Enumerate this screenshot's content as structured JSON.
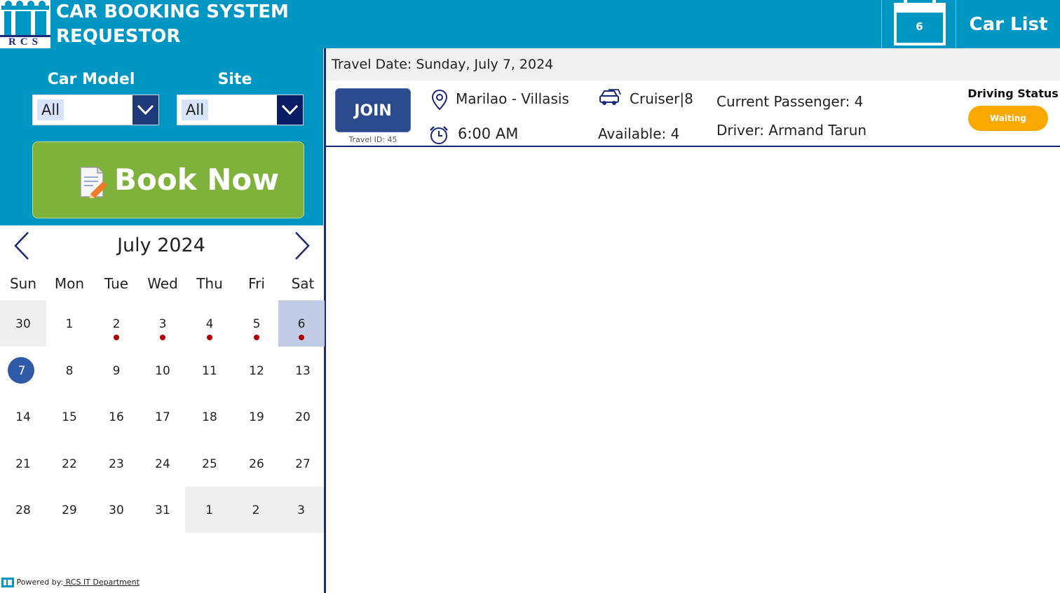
{
  "header": {
    "title_line1": "CAR BOOKING SYSTEM",
    "title_line2": "REQUESTOR",
    "logo_text": "RCS",
    "calendar_day": "6",
    "car_list_label": "Car List"
  },
  "filters": {
    "car_model_label": "Car Model",
    "car_model_value": "All",
    "site_label": "Site",
    "site_value": "All"
  },
  "book_now_label": "Book Now",
  "calendar": {
    "month_label": "July 2024",
    "weekdays": [
      "Sun",
      "Mon",
      "Tue",
      "Wed",
      "Thu",
      "Fri",
      "Sat"
    ],
    "weeks": [
      [
        "30",
        "1",
        "2",
        "3",
        "4",
        "5",
        "6"
      ],
      [
        "7",
        "8",
        "9",
        "10",
        "11",
        "12",
        "13"
      ],
      [
        "14",
        "15",
        "16",
        "17",
        "18",
        "19",
        "20"
      ],
      [
        "21",
        "22",
        "23",
        "24",
        "25",
        "26",
        "27"
      ],
      [
        "28",
        "29",
        "30",
        "31",
        "1",
        "2",
        "3"
      ]
    ]
  },
  "footer": {
    "prefix": "Powered by:",
    "link": " RCS IT Department"
  },
  "travel": {
    "date_label": "Travel Date: Sunday, July 7, 2024",
    "join_label": "JOIN",
    "travel_id": "Travel ID: 45",
    "route": "Marilao - Villasis",
    "time": "6:00 AM",
    "car": "Cruiser|8",
    "available": "Available: 4",
    "current_passenger": "Current Passenger: 4",
    "driver": "Driver: Armand Tarun",
    "status_title": "Driving Status",
    "status_value": "Waiting"
  },
  "colors": {
    "header_bg": "#0096c4",
    "book_now_bg": "#7fb23b",
    "join_bg": "#2a4a8c",
    "status_waiting": "#f8a800",
    "today_circle": "#2f5aa8",
    "event_dot": "#b00000"
  }
}
